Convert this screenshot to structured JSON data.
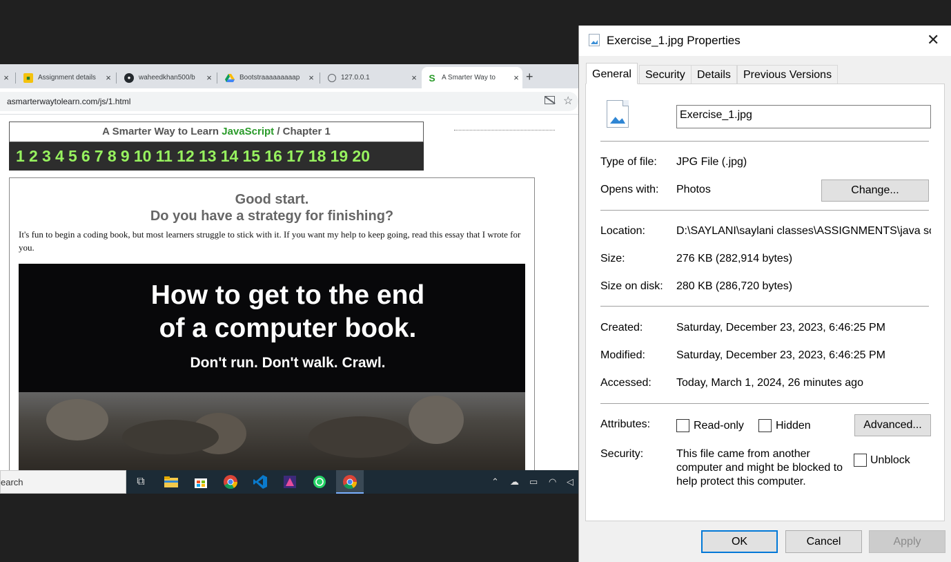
{
  "browser": {
    "tabs": [
      {
        "title": "",
        "active": false
      },
      {
        "title": "Assignment details",
        "active": false
      },
      {
        "title": "waheedkhan500/b",
        "active": false
      },
      {
        "title": "Bootstraaaaaaaaap",
        "active": false
      },
      {
        "title": "127.0.0.1",
        "active": false
      },
      {
        "title": "A Smarter Way to",
        "active": true
      }
    ],
    "close_glyph": "×",
    "new_tab_glyph": "+",
    "url": "asmarterwaytolearn.com/js/1.html"
  },
  "page": {
    "header_prefix": "A Smarter Way to Learn ",
    "header_js": "JavaScript",
    "header_suffix": " / Chapter 1",
    "chapters": [
      "1",
      "2",
      "3",
      "4",
      "5",
      "6",
      "7",
      "8",
      "9",
      "10",
      "11",
      "12",
      "13",
      "14",
      "15",
      "16",
      "17",
      "18",
      "19",
      "20"
    ],
    "heading1": "Good start.",
    "heading2": "Do you have a strategy for finishing?",
    "intro": "It's fun to begin a coding book, but most learners struggle to stick with it. If you want my help to keep going, read this essay that I wrote for you.",
    "promo_line1": "How to get to the end",
    "promo_line2": "of a computer book.",
    "promo_line3": "Don't run. Don't walk. Crawl."
  },
  "taskbar": {
    "search_text": "earch",
    "icons": [
      "task-view-icon",
      "file-explorer-icon",
      "store-icon",
      "chrome-icon",
      "vscode-icon",
      "app-icon",
      "whatsapp-icon",
      "chrome-active-icon"
    ]
  },
  "dialog": {
    "title": "Exercise_1.jpg Properties",
    "close_glyph": "✕",
    "tabs": [
      "General",
      "Security",
      "Details",
      "Previous Versions"
    ],
    "file_name": "Exercise_1.jpg",
    "type_label": "Type of file:",
    "type_value": "JPG File (.jpg)",
    "opens_label": "Opens with:",
    "opens_value": "Photos",
    "change_button": "Change...",
    "location_label": "Location:",
    "location_value": "D:\\SAYLANI\\saylani classes\\ASSIGNMENTS\\java sc",
    "size_label": "Size:",
    "size_value": "276 KB (282,914 bytes)",
    "size_disk_label": "Size on disk:",
    "size_disk_value": "280 KB (286,720 bytes)",
    "created_label": "Created:",
    "created_value": "Saturday, December 23, 2023, 6:46:25 PM",
    "modified_label": "Modified:",
    "modified_value": "Saturday, December 23, 2023, 6:46:25 PM",
    "accessed_label": "Accessed:",
    "accessed_value": "Today, March 1, 2024, 26 minutes ago",
    "attributes_label": "Attributes:",
    "readonly_label": "Read-only",
    "hidden_label": "Hidden",
    "advanced_button": "Advanced...",
    "security_label": "Security:",
    "security_text": "This file came from another computer and might be blocked to help protect this computer.",
    "unblock_label": "Unblock",
    "ok_button": "OK",
    "cancel_button": "Cancel",
    "apply_button": "Apply"
  },
  "colors": {
    "chapter_numbers": "#97f25f",
    "javascript_link": "#2a9b2a",
    "default_button_border": "#0078d7"
  }
}
